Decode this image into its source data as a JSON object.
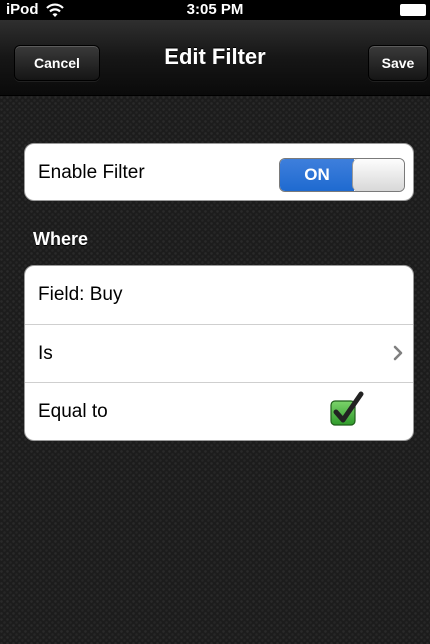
{
  "status_bar": {
    "carrier": "iPod",
    "time": "3:05 PM"
  },
  "nav": {
    "title": "Edit Filter",
    "cancel_label": "Cancel",
    "save_label": "Save"
  },
  "enable_filter": {
    "label": "Enable Filter",
    "switch_state": "ON"
  },
  "section_header": "Where",
  "rows": [
    {
      "label": "Field: Buy"
    },
    {
      "label": "Is",
      "accessory": "chevron-right-icon"
    },
    {
      "label": "Equal to",
      "accessory": "green-checkbox-icon",
      "checked": true
    }
  ],
  "colors": {
    "switch_on": "#2a74d6",
    "checkbox_green": "#3cb43c"
  }
}
